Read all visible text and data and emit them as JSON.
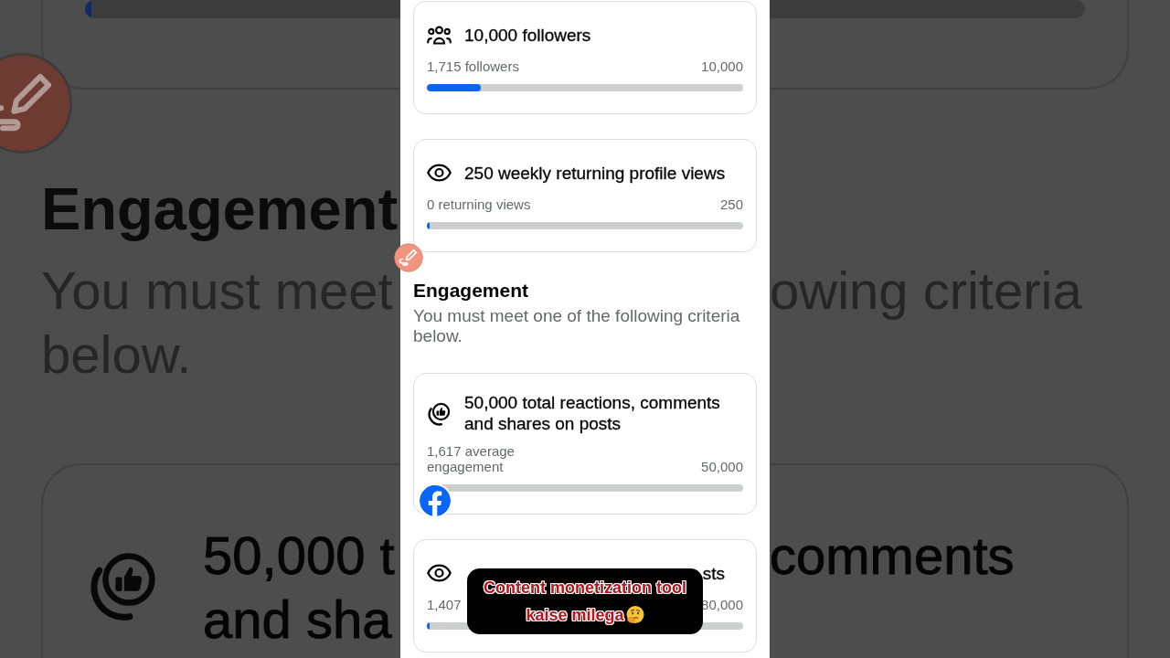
{
  "backdrop": {
    "progress": {
      "level": 0
    },
    "left": {
      "heading": "Engagement",
      "description": [
        "You must meet",
        "below."
      ],
      "card_title": [
        "50,000 t",
        "and sha"
      ]
    },
    "right": {
      "description": [
        "owing criteria"
      ],
      "card_title": [
        "comments"
      ]
    }
  },
  "requirements": [
    {
      "kind": "followers",
      "title": "10,000 followers",
      "title_covered": false,
      "current": "1,715 followers",
      "target": "10,000",
      "level": 0.17
    },
    {
      "kind": "views",
      "title": "250 weekly returning profile views",
      "title_covered": false,
      "current": "0 returning views",
      "target": "250",
      "level": 0
    }
  ],
  "engagement": {
    "title": "Engagement",
    "description": "You must meet one of the following criteria below.",
    "criteria": [
      {
        "kind": "engagement",
        "title": "50,000 total reactions, comments and shares on posts",
        "title_covered": false,
        "current": "1,617 average engagement",
        "target": "50,000",
        "level": 0.03
      },
      {
        "kind": "views",
        "title": "sts",
        "title_covered": true,
        "current": "1,407",
        "target": "80,000",
        "level": 0.01
      }
    ]
  },
  "caption": {
    "lines": [
      "Content monetization tool",
      "kaise milega"
    ]
  }
}
